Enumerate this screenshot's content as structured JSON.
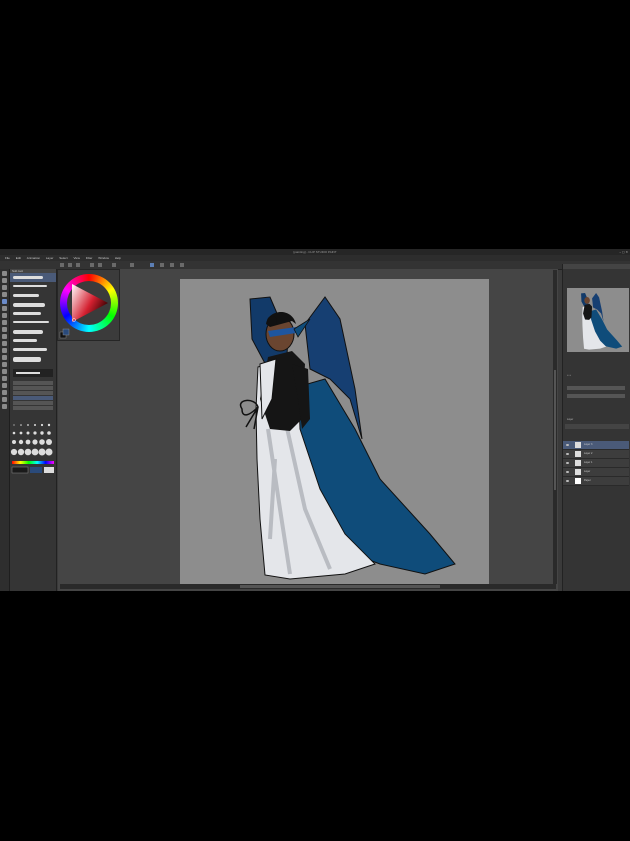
{
  "window": {
    "title": "[painting] - CLIP STUDIO PAINT",
    "controls": "– ▢ ✕"
  },
  "menu": [
    "File",
    "Edit",
    "Animation",
    "Layer",
    "Select",
    "View",
    "Filter",
    "Window",
    "Help"
  ],
  "subtool": {
    "tab_label": "Sub tool",
    "brushes": [
      "brush",
      "pencil",
      "brush",
      "brush",
      "brush",
      "brush",
      "brush",
      "brush",
      "brush",
      "brush"
    ]
  },
  "right_panel": {
    "layers_label": "Layer",
    "layers": [
      {
        "name": "Layer 3"
      },
      {
        "name": "Layer 2"
      },
      {
        "name": "Layer 1"
      },
      {
        "name": "Layer"
      },
      {
        "name": "Paper"
      }
    ]
  },
  "colors": {
    "app_bg": "#3a3a3a",
    "canvas_bg": "#8d8d8d",
    "wings": "#123a69",
    "cape": "#0f4c7a",
    "dress": "#e4e6ea",
    "outline": "#111111"
  },
  "icons": [
    "pen-icon",
    "eraser-icon",
    "fill-icon",
    "selection-icon",
    "eye-icon",
    "color-wheel-icon"
  ]
}
